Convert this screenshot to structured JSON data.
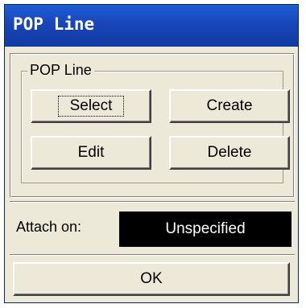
{
  "window": {
    "title": "POP Line"
  },
  "group": {
    "label": "POP Line",
    "buttons": {
      "select": "Select",
      "create": "Create",
      "edit": "Edit",
      "delete": "Delete"
    }
  },
  "attach": {
    "label": "Attach on:",
    "value": "Unspecified"
  },
  "footer": {
    "ok_label": "OK"
  },
  "colors": {
    "titlebar": "#1846b8",
    "dialog_background": "#ece9d8",
    "attach_value_background": "#000000",
    "attach_value_text": "#ffffff"
  }
}
